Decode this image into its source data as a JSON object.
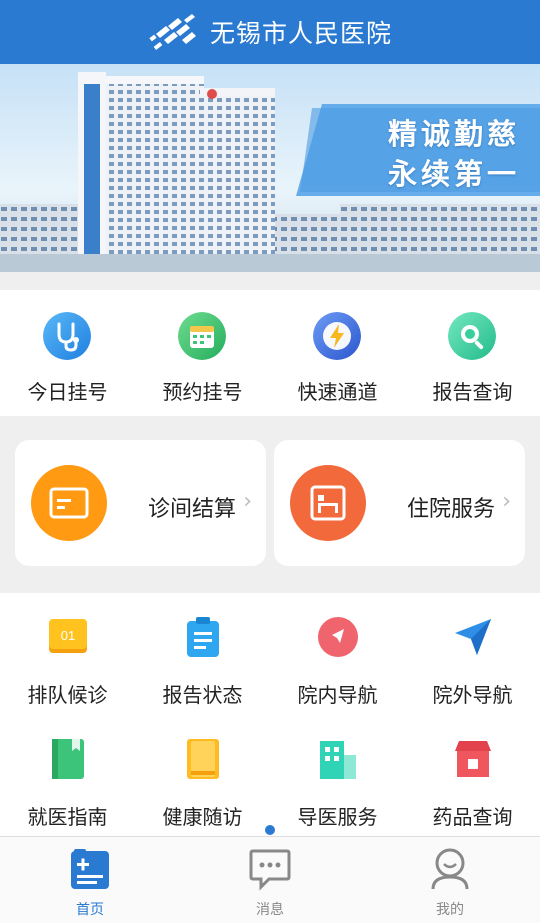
{
  "header": {
    "title": "无锡市人民医院"
  },
  "banner": {
    "slogan_line1": "精诚勤慈",
    "slogan_line2": "永续第一"
  },
  "quick_actions": [
    {
      "label": "今日挂号",
      "icon": "stethoscope-icon",
      "color": "#2f8fe6"
    },
    {
      "label": "预约挂号",
      "icon": "calendar-icon",
      "color": "#3cc47a"
    },
    {
      "label": "快速通道",
      "icon": "lightning-icon",
      "color": "#3a6fe0"
    },
    {
      "label": "报告查询",
      "icon": "search-icon",
      "color": "#38cf9c"
    }
  ],
  "cards": [
    {
      "label": "诊间结算",
      "icon": "payment-card-icon",
      "color": "#ff9a12"
    },
    {
      "label": "住院服务",
      "icon": "hospital-bed-icon",
      "color": "#f26a3c"
    }
  ],
  "services": [
    {
      "label": "排队候诊",
      "icon": "queue-number-icon",
      "badge": "01",
      "color": "#ffb91f"
    },
    {
      "label": "报告状态",
      "icon": "clipboard-icon",
      "color": "#2fa7f0"
    },
    {
      "label": "院内导航",
      "icon": "compass-icon",
      "color": "#f0646e"
    },
    {
      "label": "院外导航",
      "icon": "send-arrow-icon",
      "color": "#2f8fe6"
    },
    {
      "label": "就医指南",
      "icon": "book-icon",
      "color": "#3cc47a"
    },
    {
      "label": "健康随访",
      "icon": "notebook-icon",
      "color": "#ffb91f"
    },
    {
      "label": "导医服务",
      "icon": "building-icon",
      "color": "#2fd4b6"
    },
    {
      "label": "药品查询",
      "icon": "pharmacy-store-icon",
      "color": "#f0565e"
    }
  ],
  "tabs": [
    {
      "label": "首页",
      "icon": "home-document-icon",
      "active": true
    },
    {
      "label": "消息",
      "icon": "chat-bubble-icon",
      "active": false
    },
    {
      "label": "我的",
      "icon": "user-icon",
      "active": false
    }
  ],
  "colors": {
    "brand": "#2a7ad2",
    "active_tab": "#2a7ad2",
    "inactive_tab": "#888888"
  }
}
